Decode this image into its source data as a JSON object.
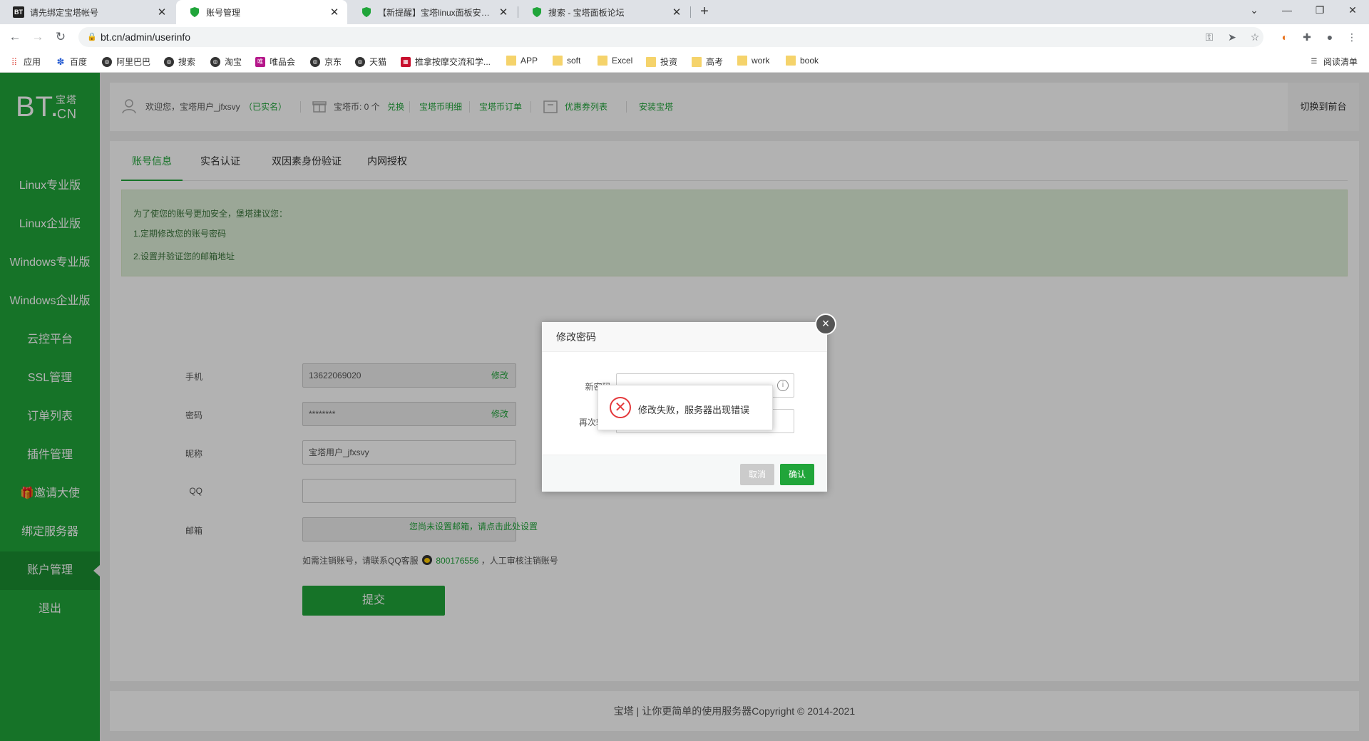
{
  "browser": {
    "tabs": [
      {
        "icon": "BT",
        "title": "请先绑定宝塔帐号",
        "active": false
      },
      {
        "icon": "shield",
        "title": "账号管理",
        "active": true
      },
      {
        "icon": "shield",
        "title": "【新提醒】宝塔linux面板安装便",
        "active": false
      },
      {
        "icon": "shield",
        "title": "搜索 - 宝塔面板论坛",
        "active": false
      }
    ],
    "new_tab": "+",
    "url": "bt.cn/admin/userinfo",
    "bookmarks": [
      "应用",
      "百度",
      "阿里巴巴",
      "搜索",
      "淘宝",
      "唯品会",
      "京东",
      "天猫",
      "推拿按摩交流和学...",
      "APP",
      "soft",
      "Excel",
      "投资",
      "高考",
      "work",
      "book"
    ],
    "reading_list": "阅读清单"
  },
  "sidebar": {
    "logo": "BT.",
    "logo_small": "宝塔",
    "logo_cn": "CN",
    "items": [
      "Linux专业版",
      "Linux企业版",
      "Windows专业版",
      "Windows企业版",
      "云控平台",
      "SSL管理",
      "订单列表",
      "插件管理",
      "🎁邀请大使",
      "绑定服务器",
      "账户管理",
      "退出"
    ],
    "active_index": 10
  },
  "topbar": {
    "welcome": "欢迎您，宝塔用户_jfxsvy",
    "verified": "（已实名）",
    "coins": "宝塔币: 0 个",
    "exchange": "兑换",
    "coin_detail": "宝塔币明细",
    "coin_orders": "宝塔币订单",
    "coupons": "优惠券列表",
    "install": "安装宝塔",
    "switch_front": "切换到前台"
  },
  "subtabs": [
    "账号信息",
    "实名认证",
    "双因素身份验证",
    "内网授权"
  ],
  "notice": {
    "line1": "为了使您的账号更加安全，堡塔建议您：",
    "line2": "1.定期修改您的账号密码",
    "line3": "2.设置并验证您的邮箱地址"
  },
  "form": {
    "phone_label": "手机",
    "phone_value": "13622069020",
    "phone_modify": "修改",
    "password_label": "密码",
    "password_value": "********",
    "password_modify": "修改",
    "nickname_label": "昵称",
    "nickname_value": "宝塔用户_jfxsvy",
    "qq_label": "QQ",
    "qq_value": "",
    "email_label": "邮箱",
    "email_value": "",
    "email_tip": "您尚未设置邮箱，请点击此处设置",
    "cancel_note_prefix": "如需注销账号，请联系QQ客服",
    "cancel_qq": "800176556",
    "cancel_note_suffix": "，人工审核注销账号",
    "submit": "提交"
  },
  "footer": "宝塔 | 让你更简单的使用服务器Copyright © 2014-2021",
  "modal": {
    "title": "修改密码",
    "new_password_label": "新密码:",
    "repeat_label": "再次输入",
    "cancel": "取消",
    "confirm": "确认",
    "close": "×"
  },
  "toast": {
    "message": "修改失败，服务器出现错误"
  },
  "colors": {
    "brand_green": "#20a53a",
    "error_red": "#e4393c"
  }
}
